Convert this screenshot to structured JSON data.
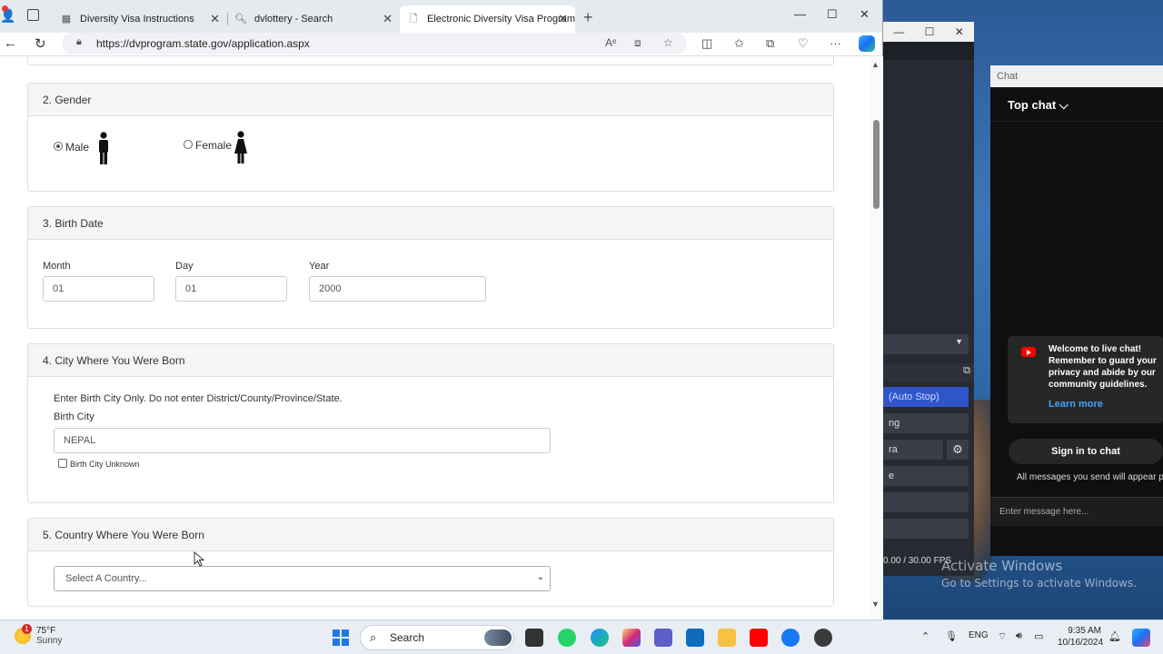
{
  "browser": {
    "tabs": [
      {
        "title": "Diversity Visa Instructions",
        "icon": "page-icon"
      },
      {
        "title": "dvlottery - Search",
        "icon": "search-icon"
      },
      {
        "title": "Electronic Diversity Visa Program",
        "icon": "page-icon",
        "active": true
      }
    ],
    "url": "https://dvprogram.state.gov/application.aspx"
  },
  "form": {
    "gender": {
      "heading": "2. Gender",
      "male_label": "Male",
      "female_label": "Female",
      "selected": "Male"
    },
    "birth_date": {
      "heading": "3. Birth Date",
      "month_label": "Month",
      "day_label": "Day",
      "year_label": "Year",
      "month_value": "01",
      "day_value": "01",
      "year_value": "2000"
    },
    "birth_city": {
      "heading": "4. City Where You Were Born",
      "instruction": "Enter Birth City Only. Do not enter District/County/Province/State.",
      "city_label": "Birth City",
      "city_value": "NEPAL",
      "unknown_label": "Birth City Unknown",
      "unknown_checked": false
    },
    "birth_country": {
      "heading": "5. Country Where You Were Born",
      "select_value": "Select A Country..."
    }
  },
  "chat": {
    "window_title": "Chat",
    "top_chat": "Top chat",
    "welcome": "Welcome to live chat! Remember to guard your privacy and abide by our community guidelines.",
    "learn_more": "Learn more",
    "sign_in": "Sign in to chat",
    "notice": "All messages you send will appear pu",
    "placeholder": "Enter message here..."
  },
  "obs": {
    "auto_stop": "(Auto Stop)",
    "item2": "ng",
    "item3": "ra",
    "item4": "e",
    "fps": "0.00 / 30.00 FPS"
  },
  "watermark": {
    "line1": "Activate Windows",
    "line2": "Go to Settings to activate Windows."
  },
  "taskbar": {
    "weather_temp": "75°F",
    "weather_cond": "Sunny",
    "weather_badge": "1",
    "search_label": "Search",
    "language": "ENG",
    "time": "9:35 AM",
    "date": "10/16/2024"
  },
  "colors": {
    "panel_header": "#f5f5f5",
    "accent_blue": "#2f55c9",
    "youtube_red": "#ff0000"
  }
}
